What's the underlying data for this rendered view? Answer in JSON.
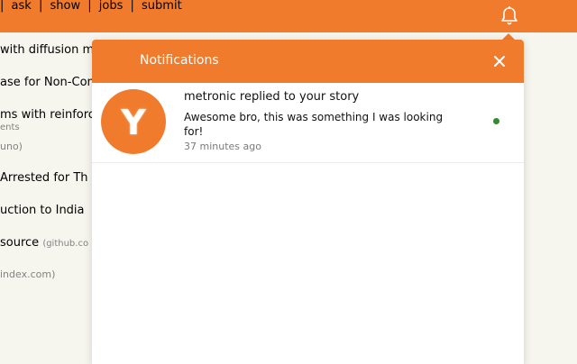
{
  "nav": {
    "items": [
      "ask",
      "show",
      "jobs",
      "submit"
    ],
    "separator": "|",
    "bell_icon": "bell-icon"
  },
  "background_list": {
    "lines": [
      {
        "text": "with diffusion m",
        "meta": ""
      },
      {
        "text": "ase for Non-Com",
        "meta": ""
      },
      {
        "text": "ms with reinforc",
        "meta": ""
      },
      {
        "text": "ents",
        "meta": ""
      },
      {
        "text": "uno)",
        "meta": ""
      },
      {
        "text": "Arrested for Th",
        "meta": ""
      },
      {
        "text": "uction to India",
        "meta": ""
      },
      {
        "text": "source",
        "meta": "(github.co"
      },
      {
        "text": "index.com)",
        "meta": ""
      }
    ]
  },
  "notifications": {
    "title": "Notifications",
    "close_icon": "close-icon",
    "items": [
      {
        "avatar_letter": "Y",
        "title": "metronic replied to your story",
        "body": "Awesome bro, this was something I was looking for!",
        "time": "37 minutes ago",
        "unread": true
      }
    ]
  },
  "colors": {
    "accent": "#f07b2d",
    "background": "#f6f6ef",
    "unread": "#2e8b2e"
  }
}
